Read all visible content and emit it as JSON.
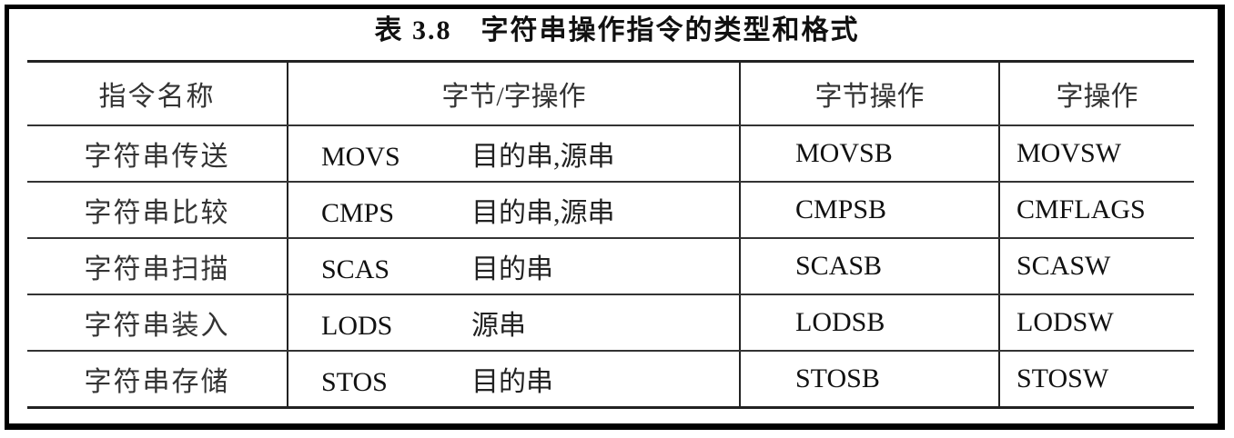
{
  "title": "表 3.8　字符串操作指令的类型和格式",
  "headers": [
    "指令名称",
    "字节/字操作",
    "字节操作",
    "字操作"
  ],
  "rows": [
    {
      "name": "字符串传送",
      "op": "MOVS",
      "args": "目的串,源串",
      "byte": "MOVSB",
      "word": "MOVSW"
    },
    {
      "name": "字符串比较",
      "op": "CMPS",
      "args": "目的串,源串",
      "byte": "CMPSB",
      "word": "CMFLAGS"
    },
    {
      "name": "字符串扫描",
      "op": "SCAS",
      "args": "目的串",
      "byte": "SCASB",
      "word": "SCASW"
    },
    {
      "name": "字符串装入",
      "op": "LODS",
      "args": "源串",
      "byte": "LODSB",
      "word": "LODSW"
    },
    {
      "name": "字符串存储",
      "op": "STOS",
      "args": "目的串",
      "byte": "STOSB",
      "word": "STOSW"
    }
  ]
}
